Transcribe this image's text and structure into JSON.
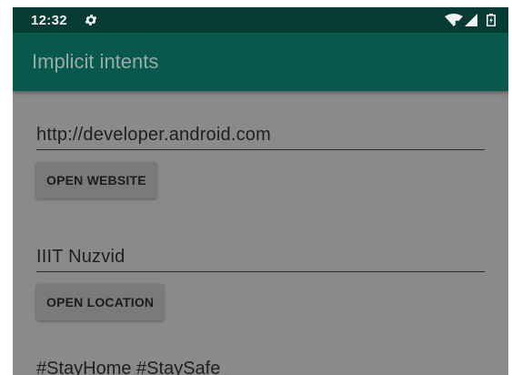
{
  "status_bar": {
    "time": "12:32",
    "icons": [
      "settings-gear-icon",
      "wifi-icon",
      "signal-icon",
      "battery-icon"
    ]
  },
  "app_bar": {
    "title": "Implicit intents"
  },
  "website": {
    "value": "http://developer.android.com",
    "button_label": "OPEN WEBSITE"
  },
  "location": {
    "value": "IIIT Nuzvid",
    "button_label": "OPEN LOCATION"
  },
  "share": {
    "value": "#StayHome #StaySafe"
  },
  "colors": {
    "status_bar": "#063b33",
    "app_bar": "#06594c",
    "scrim_background": "#8a8a8a",
    "button": "#7a7a7a"
  }
}
